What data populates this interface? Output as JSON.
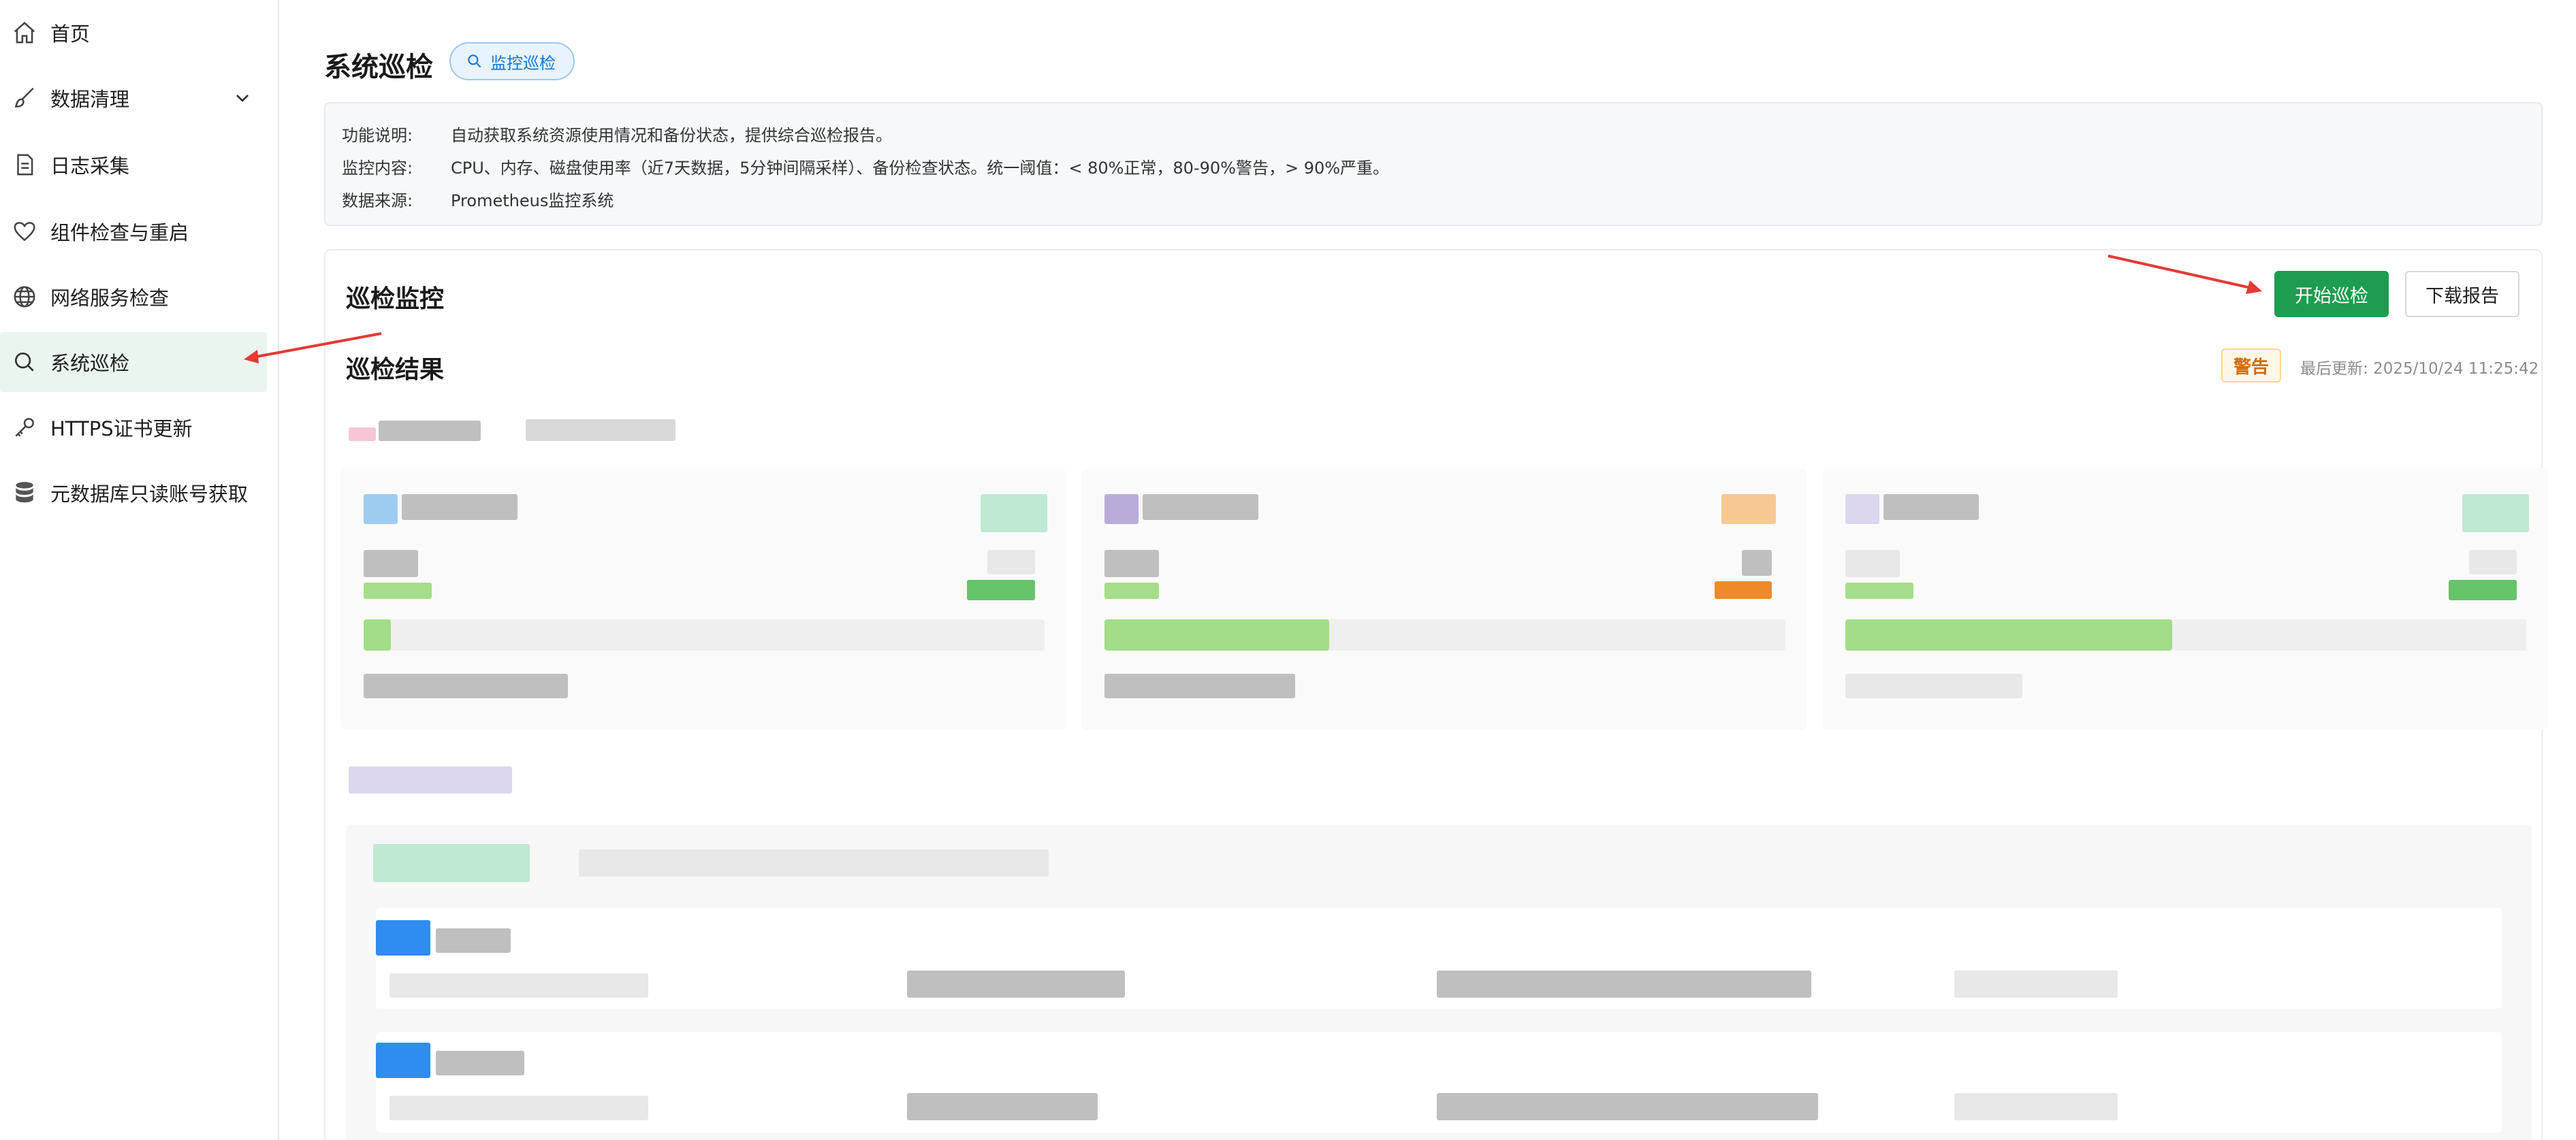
{
  "sidebar": {
    "items": [
      {
        "label": "首页",
        "icon": "home-icon"
      },
      {
        "label": "数据清理",
        "icon": "brush-icon",
        "expandable": true
      },
      {
        "label": "日志采集",
        "icon": "document-icon"
      },
      {
        "label": "组件检查与重启",
        "icon": "heart-icon"
      },
      {
        "label": "网络服务检查",
        "icon": "globe-icon"
      },
      {
        "label": "系统巡检",
        "icon": "search-icon",
        "active": true
      },
      {
        "label": "HTTPS证书更新",
        "icon": "key-icon"
      },
      {
        "label": "元数据库只读账号获取",
        "icon": "database-icon"
      }
    ]
  },
  "header": {
    "title": "系统巡检",
    "tag": "监控巡检"
  },
  "description": {
    "rows": [
      {
        "label": "功能说明:",
        "value": "自动获取系统资源使用情况和备份状态，提供综合巡检报告。"
      },
      {
        "label": "监控内容:",
        "value": "CPU、内存、磁盘使用率（近7天数据，5分钟间隔采样）、备份检查状态。统一阈值：< 80%正常，80-90%警告，> 90%严重。"
      },
      {
        "label": "数据来源:",
        "value": "Prometheus监控系统"
      }
    ]
  },
  "panel": {
    "title": "巡检监控",
    "start_button": "开始巡检",
    "download_button": "下载报告",
    "results_title": "巡检结果",
    "status": "警告",
    "last_update": "最后更新: 2025/10/24 11:25:42"
  },
  "cards": [
    {
      "usage": 0.04
    },
    {
      "usage": 0.33
    },
    {
      "usage": 0.48
    }
  ],
  "colors": {
    "primary": "#1c9d4f",
    "active_bg": "#e9f5ee",
    "warning": "#d46b08",
    "tag_blue": "#1677d2",
    "annotation_red": "#e53935"
  }
}
